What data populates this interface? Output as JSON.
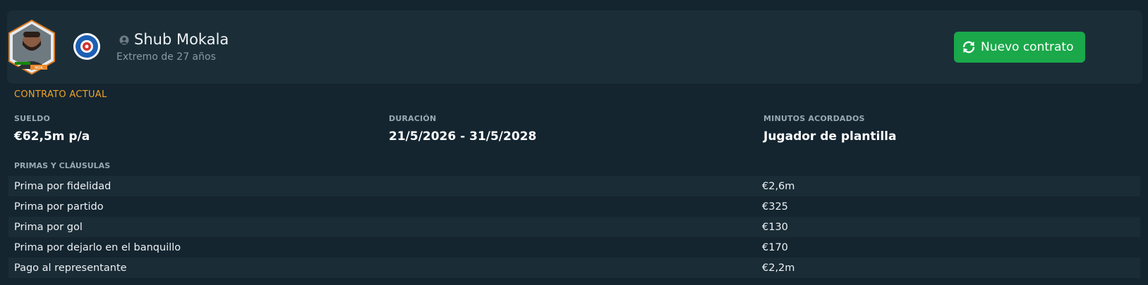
{
  "player": {
    "name": "Shub Mokala",
    "subtitle": "Extremo de 27 años",
    "flag_badge_text": "MOK"
  },
  "actions": {
    "new_contract_label": "Nuevo contrato"
  },
  "contract": {
    "section_title": "CONTRATO ACTUAL",
    "wage_label": "SUELDO",
    "wage_value": "€62,5m p/a",
    "duration_label": "DURACIÓN",
    "duration_value": "21/5/2026 - 31/5/2028",
    "minutes_label": "MINUTOS ACORDADOS",
    "minutes_value": "Jugador de plantilla"
  },
  "bonuses": {
    "title": "PRIMAS Y CLÁUSULAS",
    "rows": [
      {
        "name": "Prima por fidelidad",
        "value": "€2,6m"
      },
      {
        "name": "Prima por partido",
        "value": "€325"
      },
      {
        "name": "Prima por gol",
        "value": "€130"
      },
      {
        "name": "Prima por dejarlo en el banquillo",
        "value": "€170"
      },
      {
        "name": "Pago al representante",
        "value": "€2,2m"
      }
    ]
  },
  "colors": {
    "background": "#142530",
    "panel": "#1b2e38",
    "accent_orange": "#f0a429",
    "button_green": "#1aa84a"
  },
  "icons": {
    "avatar": "player-photo",
    "club": "club-crest",
    "person": "person-icon",
    "refresh": "refresh-icon"
  }
}
